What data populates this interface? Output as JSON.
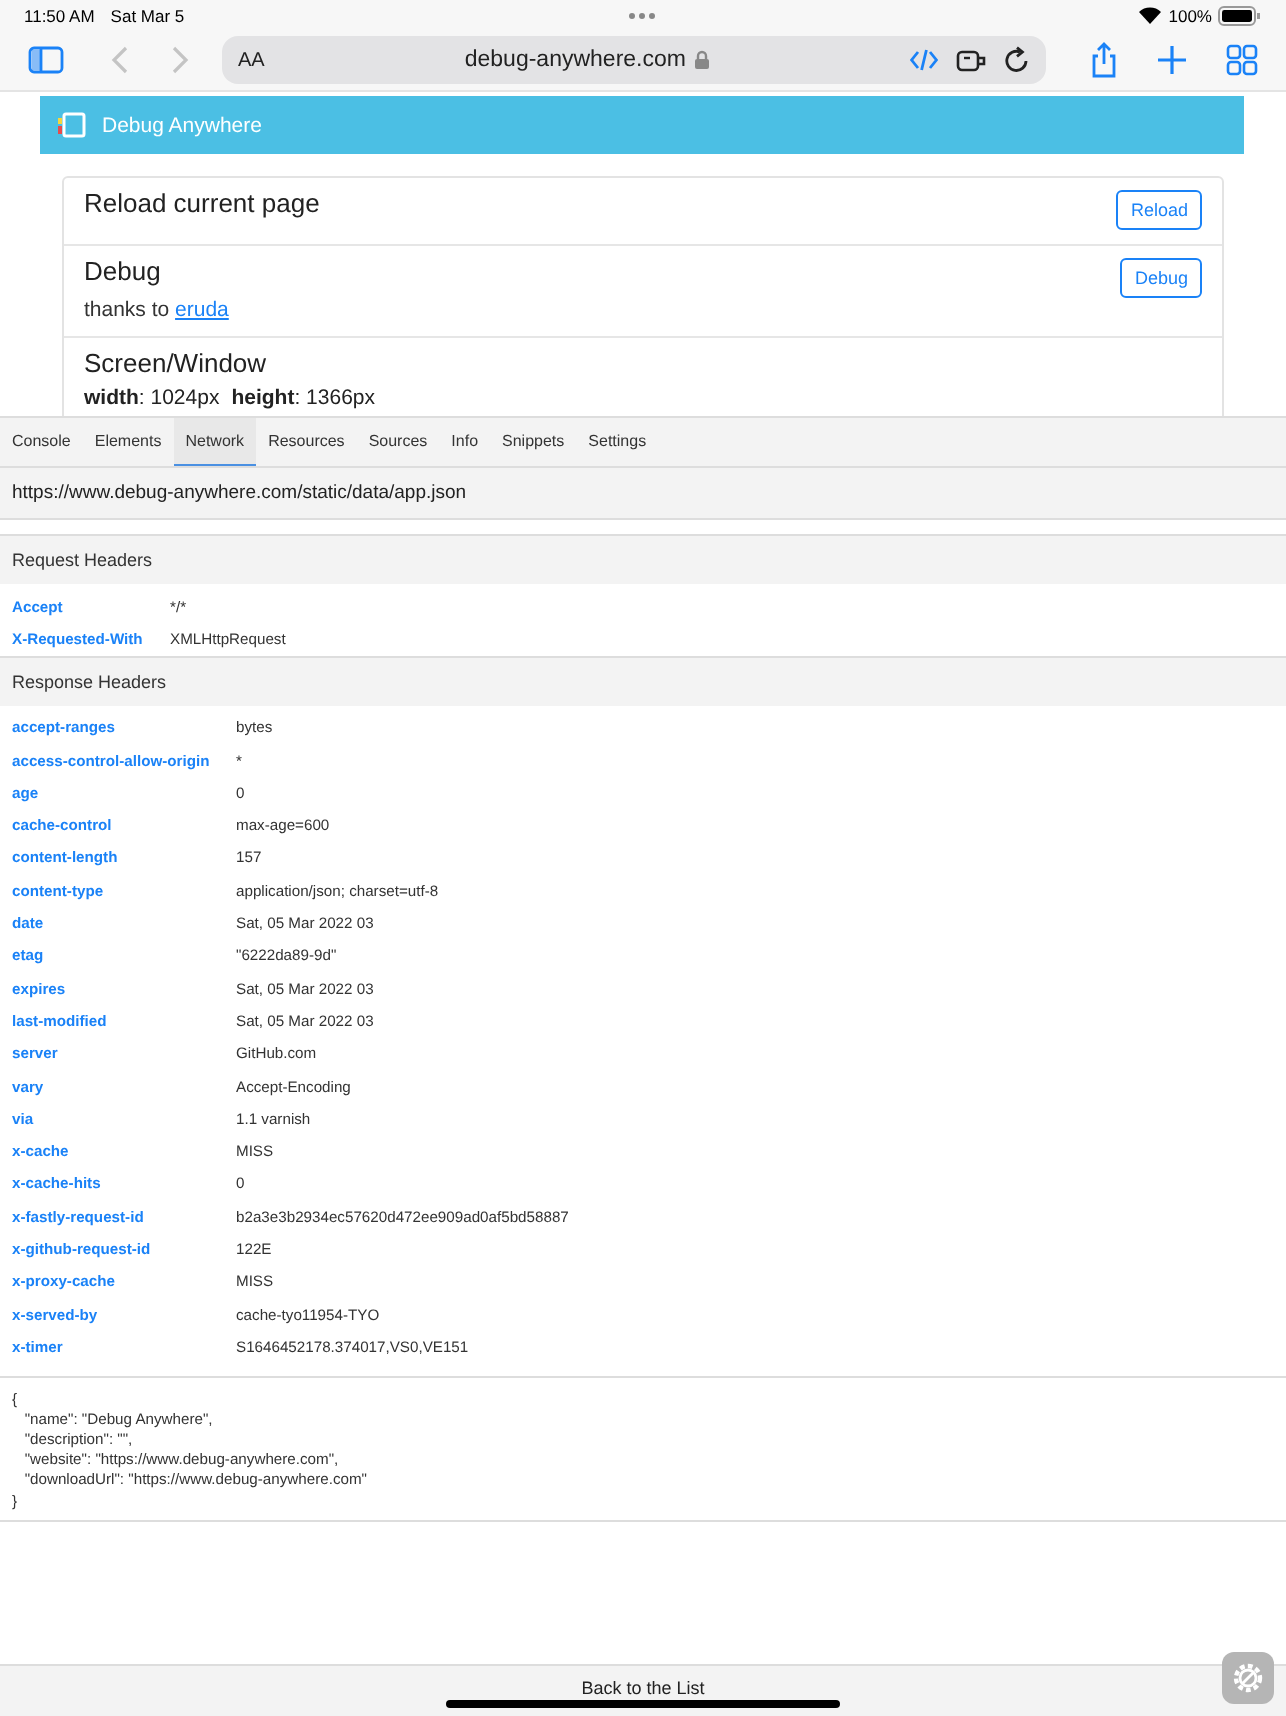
{
  "status_bar": {
    "time": "11:50 AM",
    "date": "Sat Mar 5",
    "battery": "100%"
  },
  "browser": {
    "text_size": "AA",
    "address": "debug-anywhere.com"
  },
  "page": {
    "title": "Debug Anywhere",
    "sections": [
      {
        "heading": "Reload current page",
        "button": "Reload"
      },
      {
        "heading": "Debug",
        "button": "Debug",
        "note": "thanks to",
        "link": "eruda"
      }
    ],
    "screen": {
      "heading": "Screen/Window",
      "stats": [
        "**width**: 1024px",
        "**height**: 1366px"
      ]
    }
  },
  "devtools": {
    "tabs": [
      {
        "label": "Console",
        "selected": false
      },
      {
        "label": "Elements",
        "selected": false
      },
      {
        "label": "Network",
        "selected": true
      },
      {
        "label": "Resources",
        "selected": false
      },
      {
        "label": "Sources",
        "selected": false
      },
      {
        "label": "Info",
        "selected": false
      },
      {
        "label": "Snippets",
        "selected": false
      },
      {
        "label": "Settings",
        "selected": false
      }
    ],
    "url": "https://www.debug-anywhere.com/static/data/app.json",
    "header_groups": [
      {
        "title": "Request Headers",
        "rows": [
          {
            "name": "Accept",
            "value": "*/*"
          },
          {
            "name": "X-Requested-With",
            "value": "XMLHttpRequest"
          }
        ]
      },
      {
        "title": "Response Headers",
        "rows": [
          {
            "name": "accept-ranges",
            "value": "bytes"
          },
          {
            "name": "access-control-allow-origin",
            "value": "*"
          },
          {
            "name": "age",
            "value": "0"
          },
          {
            "name": "cache-control",
            "value": "max-age=600"
          },
          {
            "name": "content-length",
            "value": "157"
          },
          {
            "name": "content-type",
            "value": "application/json; charset=utf-8"
          },
          {
            "name": "date",
            "value": "Sat, 05 Mar 2022 03"
          },
          {
            "name": "etag",
            "value": "\"6222da89-9d\""
          },
          {
            "name": "expires",
            "value": "Sat, 05 Mar 2022 03"
          },
          {
            "name": "last-modified",
            "value": "Sat, 05 Mar 2022 03"
          },
          {
            "name": "server",
            "value": "GitHub.com"
          },
          {
            "name": "vary",
            "value": "Accept-Encoding"
          },
          {
            "name": "via",
            "value": "1.1 varnish"
          },
          {
            "name": "x-cache",
            "value": "MISS"
          },
          {
            "name": "x-cache-hits",
            "value": "0"
          },
          {
            "name": "x-fastly-request-id",
            "value": "b2a3e3b2934ec57620d472ee909ad0af5bd58887"
          },
          {
            "name": "x-github-request-id",
            "value": "122E"
          },
          {
            "name": "x-proxy-cache",
            "value": "MISS"
          },
          {
            "name": "x-served-by",
            "value": "cache-tyo11954-TYO"
          },
          {
            "name": "x-timer",
            "value": "S1646452178.374017,VS0,VE151"
          }
        ]
      }
    ],
    "body": [
      "{",
      "   \"name\": \"Debug Anywhere\",",
      "   \"description\": \"\",",
      "   \"website\": \"https://www.debug-anywhere.com\",",
      "   \"downloadUrl\": \"https://www.debug-anywhere.com\"",
      "}"
    ],
    "footer": "Back to the List"
  }
}
